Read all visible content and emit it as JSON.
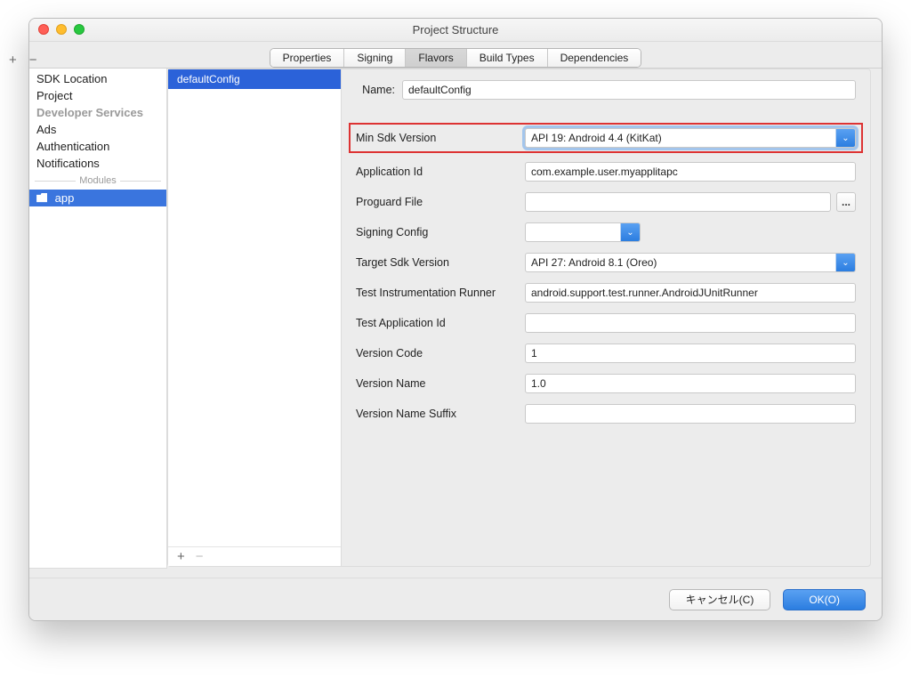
{
  "window": {
    "title": "Project Structure"
  },
  "tabs": {
    "items": [
      "Properties",
      "Signing",
      "Flavors",
      "Build Types",
      "Dependencies"
    ],
    "selected": "Flavors"
  },
  "sidebar": {
    "tools": {
      "add": "+",
      "remove": "−"
    },
    "items": [
      {
        "label": "SDK Location",
        "type": "item"
      },
      {
        "label": "Project",
        "type": "item"
      },
      {
        "label": "Developer Services",
        "type": "header"
      },
      {
        "label": "Ads",
        "type": "item"
      },
      {
        "label": "Authentication",
        "type": "item"
      },
      {
        "label": "Notifications",
        "type": "item"
      }
    ],
    "modules_divider": "Modules",
    "modules": [
      {
        "label": "app",
        "selected": true
      }
    ]
  },
  "flavors": {
    "items": [
      {
        "label": "defaultConfig",
        "selected": true
      }
    ],
    "tools": {
      "add": "+",
      "remove": "−"
    }
  },
  "form": {
    "name_label": "Name:",
    "name_value": "defaultConfig",
    "min_sdk_label": "Min Sdk Version",
    "min_sdk_value": "API 19: Android 4.4 (KitKat)",
    "app_id_label": "Application Id",
    "app_id_value": "com.example.user.myapplitapc",
    "proguard_label": "Proguard File",
    "proguard_value": "",
    "signing_label": "Signing Config",
    "signing_value": "",
    "target_sdk_label": "Target Sdk Version",
    "target_sdk_value": "API 27: Android 8.1 (Oreo)",
    "test_runner_label": "Test Instrumentation Runner",
    "test_runner_value": "android.support.test.runner.AndroidJUnitRunner",
    "test_app_id_label": "Test Application Id",
    "test_app_id_value": "",
    "version_code_label": "Version Code",
    "version_code_value": "1",
    "version_name_label": "Version Name",
    "version_name_value": "1.0",
    "version_suffix_label": "Version Name Suffix",
    "version_suffix_value": "",
    "ellipsis": "..."
  },
  "footer": {
    "cancel": "キャンセル(C)",
    "ok": "OK(O)"
  }
}
